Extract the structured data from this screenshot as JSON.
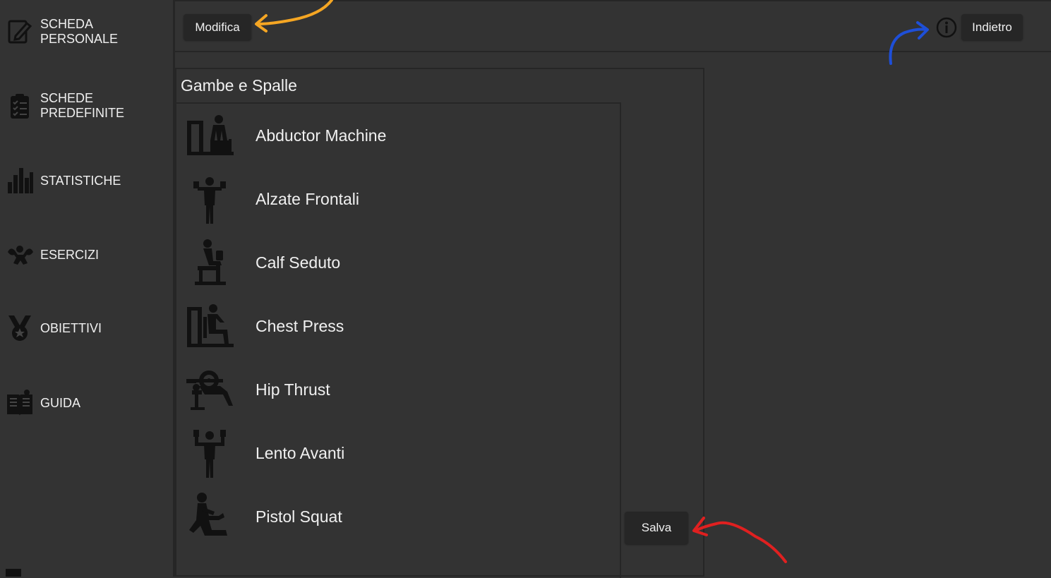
{
  "sidebar": {
    "items": [
      {
        "label": "SCHEDA\nPERSONALE",
        "icon": "edit-document-icon"
      },
      {
        "label": "SCHEDE\nPREDEFINITE",
        "icon": "clipboard-checklist-icon"
      },
      {
        "label": "STATISTICHE",
        "icon": "bar-chart-icon"
      },
      {
        "label": "ESERCIZI",
        "icon": "muscle-arm-icon"
      },
      {
        "label": "OBIETTIVI",
        "icon": "medal-icon"
      },
      {
        "label": "GUIDA",
        "icon": "book-icon"
      }
    ]
  },
  "toolbar": {
    "edit_label": "Modifica",
    "back_label": "Indietro",
    "info_icon": "info-icon"
  },
  "panel": {
    "title": "Gambe e Spalle",
    "save_label": "Salva",
    "exercises": [
      {
        "name": "Abductor Machine",
        "icon": "abductor-machine-icon"
      },
      {
        "name": "Alzate Frontali",
        "icon": "dumbbell-raise-icon"
      },
      {
        "name": "Calf Seduto",
        "icon": "seated-calf-icon"
      },
      {
        "name": "Chest Press",
        "icon": "chest-press-icon"
      },
      {
        "name": "Hip Thrust",
        "icon": "hip-thrust-icon"
      },
      {
        "name": "Lento Avanti",
        "icon": "overhead-press-icon"
      },
      {
        "name": "Pistol Squat",
        "icon": "pistol-squat-icon"
      }
    ]
  },
  "colors": {
    "background": "#333333",
    "button": "#262626",
    "annotation_orange": "#f5a623",
    "annotation_blue": "#1e4fd8",
    "annotation_red": "#e02020"
  }
}
